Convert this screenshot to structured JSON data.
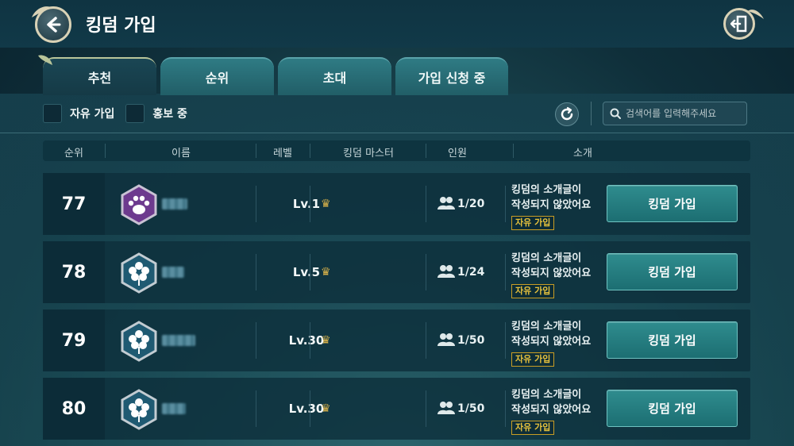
{
  "header": {
    "title": "킹덤 가입"
  },
  "tabs": [
    {
      "label": "추천",
      "active": true
    },
    {
      "label": "순위"
    },
    {
      "label": "초대"
    },
    {
      "label": "가입 신청 중"
    }
  ],
  "filters": {
    "free_join": "자유 가입",
    "promoting": "홍보 중"
  },
  "search": {
    "placeholder": "검색어를 입력해주세요"
  },
  "columns": {
    "rank": "순위",
    "name": "이름",
    "level": "레벨",
    "master": "킹덤 마스터",
    "members": "인원",
    "intro": "소개"
  },
  "rows": [
    {
      "rank": "77",
      "level": "Lv.1",
      "members": "1/20",
      "intro1": "킹덤의 소개글이",
      "intro2": "작성되지 않았어요",
      "tag": "자유 가입",
      "button": "킹덤 가입",
      "emblem": "paw-icon",
      "emblem_color": "#6d3a8e"
    },
    {
      "rank": "78",
      "level": "Lv.5",
      "members": "1/24",
      "intro1": "킹덤의 소개글이",
      "intro2": "작성되지 않았어요",
      "tag": "자유 가입",
      "button": "킹덤 가입",
      "emblem": "flower-icon",
      "emblem_color": "#1f5a72"
    },
    {
      "rank": "79",
      "level": "Lv.30",
      "members": "1/50",
      "intro1": "킹덤의 소개글이",
      "intro2": "작성되지 않았어요",
      "tag": "자유 가입",
      "button": "킹덤 가입",
      "emblem": "flower-icon",
      "emblem_color": "#1f5a72"
    },
    {
      "rank": "80",
      "level": "Lv.30",
      "members": "1/50",
      "intro1": "킹덤의 소개글이",
      "intro2": "작성되지 않았어요",
      "tag": "자유 가입",
      "button": "킹덤 가입",
      "emblem": "flower-icon",
      "emblem_color": "#1f5a72"
    }
  ],
  "colors": {
    "accent": "#2f8c8e",
    "tag": "#e7c23d",
    "crown": "#d9b24a"
  }
}
